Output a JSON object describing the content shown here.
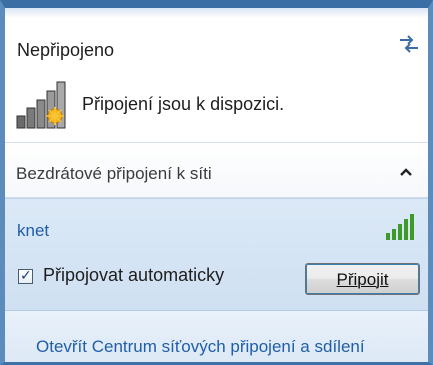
{
  "status": {
    "title": "Nepřipojeno",
    "refresh_icon": "refresh-arrows-icon"
  },
  "availability": {
    "icon": "network-available-icon",
    "text": "Připojení jsou k dispozici."
  },
  "section": {
    "label": "Bezdrátové připojení k síti",
    "toggle_icon": "chevron-up-icon"
  },
  "network": {
    "name": "knet",
    "signal_icon": "signal-strength-icon",
    "auto_connect_label": "Připojovat automaticky",
    "auto_connect_checked": true,
    "connect_label": "Připojit"
  },
  "footer": {
    "link": "Otevřít Centrum síťových připojení a sdílení"
  },
  "colors": {
    "accent": "#1f5ea8",
    "frame": "#3b6ea5",
    "card": "#d6e6f5"
  }
}
